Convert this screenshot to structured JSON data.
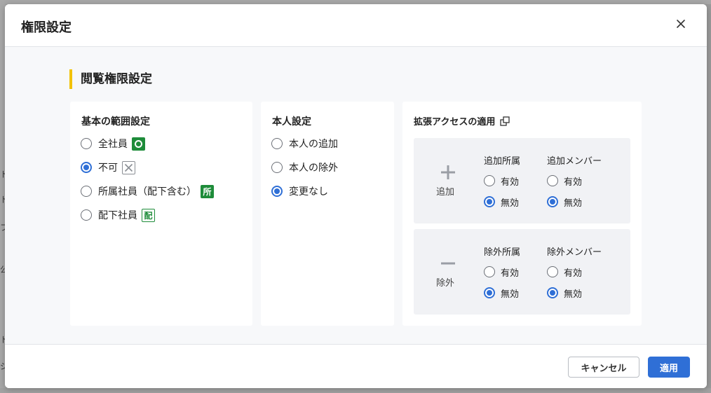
{
  "background_fragments": [
    "ト",
    "ト",
    "フ",
    "公",
    "ト",
    "ジ"
  ],
  "dialog": {
    "title": "権限設定",
    "close_icon": "close-icon"
  },
  "section": {
    "title": "閲覧権限設定",
    "accent_color": "#f2c200"
  },
  "scope": {
    "title": "基本の範囲設定",
    "options": [
      {
        "label": "全社員",
        "badge": "O",
        "checked": false
      },
      {
        "label": "不可",
        "badge": "X",
        "checked": true
      },
      {
        "label": "所属社員（配下含む）",
        "badge": "所",
        "checked": false
      },
      {
        "label": "配下社員",
        "badge": "配",
        "checked": false
      }
    ]
  },
  "self": {
    "title": "本人設定",
    "options": [
      {
        "label": "本人の追加",
        "checked": false
      },
      {
        "label": "本人の除外",
        "checked": false
      },
      {
        "label": "変更なし",
        "checked": true
      }
    ]
  },
  "extended": {
    "title": "拡張アクセスの適用",
    "title_icon": "external-link-icon",
    "add": {
      "label": "追加",
      "icon": "plus-icon",
      "dept": {
        "title": "追加所属",
        "enabled_label": "有効",
        "disabled_label": "無効",
        "selected": "disabled"
      },
      "member": {
        "title": "追加メンバー",
        "enabled_label": "有効",
        "disabled_label": "無効",
        "selected": "disabled"
      }
    },
    "remove": {
      "label": "除外",
      "icon": "minus-icon",
      "dept": {
        "title": "除外所属",
        "enabled_label": "有効",
        "disabled_label": "無効",
        "selected": "disabled"
      },
      "member": {
        "title": "除外メンバー",
        "enabled_label": "有効",
        "disabled_label": "無効",
        "selected": "disabled"
      }
    }
  },
  "footer": {
    "cancel_label": "キャンセル",
    "apply_label": "適用",
    "primary_color": "#2f6fd6"
  }
}
